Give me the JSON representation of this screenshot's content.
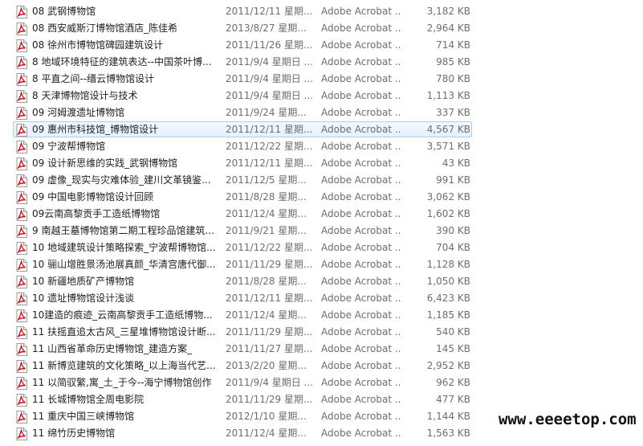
{
  "files": [
    {
      "name": "08 武钢博物馆",
      "date": "2011/12/11 星期...",
      "type": "Adobe Acrobat ...",
      "size": "3,182 KB"
    },
    {
      "name": "08 西安威斯汀博物馆酒店_陈佳希",
      "date": "2013/8/27 星期...",
      "type": "Adobe Acrobat ...",
      "size": "2,964 KB"
    },
    {
      "name": "08 徐州市博物馆碑园建筑设计",
      "date": "2011/11/26 星期...",
      "type": "Adobe Acrobat ...",
      "size": "714 KB"
    },
    {
      "name": "8 地域环境特征的建筑表达--中国茶叶博...",
      "date": "2011/9/4 星期日 ...",
      "type": "Adobe Acrobat ...",
      "size": "985 KB"
    },
    {
      "name": "8 平直之间--缙云博物馆设计",
      "date": "2011/9/4 星期日 ...",
      "type": "Adobe Acrobat ...",
      "size": "780 KB"
    },
    {
      "name": "8 天津博物馆设计与技术",
      "date": "2011/9/4 星期日 ...",
      "type": "Adobe Acrobat ...",
      "size": "1,113 KB"
    },
    {
      "name": "09 河姆渡遗址博物馆",
      "date": "2011/9/24 星期...",
      "type": "Adobe Acrobat ...",
      "size": "337 KB"
    },
    {
      "name": "09 惠州市科技馆_博物馆设计",
      "date": "2011/12/11 星期...",
      "type": "Adobe Acrobat ...",
      "size": "4,567 KB"
    },
    {
      "name": "09 宁波帮博物馆",
      "date": "2011/12/22 星期...",
      "type": "Adobe Acrobat ...",
      "size": "3,571 KB"
    },
    {
      "name": "09 设计新思维的实践_武钢博物馆",
      "date": "2011/12/11 星期...",
      "type": "Adobe Acrobat ...",
      "size": "43 KB"
    },
    {
      "name": "09 虚像_现实与灾难体验_建川文革镜鉴...",
      "date": "2011/12/5 星期...",
      "type": "Adobe Acrobat ...",
      "size": "991 KB"
    },
    {
      "name": "09 中国电影博物馆设计回顾",
      "date": "2011/8/28 星期...",
      "type": "Adobe Acrobat ...",
      "size": "3,062 KB"
    },
    {
      "name": "09云南高黎贡手工造纸博物馆",
      "date": "2011/12/4 星期...",
      "type": "Adobe Acrobat ...",
      "size": "1,602 KB"
    },
    {
      "name": "9 南越王墓博物馆第二期工程珍品馆建筑...",
      "date": "2011/9/21 星期...",
      "type": "Adobe Acrobat ...",
      "size": "390 KB"
    },
    {
      "name": "10 地域建筑设计策略探索_宁波帮博物馆...",
      "date": "2011/12/22 星期...",
      "type": "Adobe Acrobat ...",
      "size": "704 KB"
    },
    {
      "name": "10 骊山增胜景汤池展真颜_华清宫唐代御...",
      "date": "2011/11/29 星期...",
      "type": "Adobe Acrobat ...",
      "size": "1,128 KB"
    },
    {
      "name": "10 新疆地质矿产博物馆",
      "date": "2011/8/28 星期...",
      "type": "Adobe Acrobat ...",
      "size": "1,050 KB"
    },
    {
      "name": "10 遗址博物馆设计浅谈",
      "date": "2011/12/11 星期...",
      "type": "Adobe Acrobat ...",
      "size": "6,423 KB"
    },
    {
      "name": "10建造的痕迹_云南高黎贡手工造纸博物...",
      "date": "2011/12/4 星期...",
      "type": "Adobe Acrobat ...",
      "size": "1,185 KB"
    },
    {
      "name": "11 扶摇直追太古风_三星堆博物馆设计断...",
      "date": "2011/11/29 星期...",
      "type": "Adobe Acrobat ...",
      "size": "540 KB"
    },
    {
      "name": "11 山西省革命历史博物馆_建造方案_",
      "date": "2011/11/27 星期...",
      "type": "Adobe Acrobat ...",
      "size": "145 KB"
    },
    {
      "name": "11 新博览建筑的文化策略_以上海当代艺...",
      "date": "2013/2/20 星期...",
      "type": "Adobe Acrobat ...",
      "size": "2,952 KB"
    },
    {
      "name": "11 以简驭繁,寓_土_于今--海宁博物馆创作",
      "date": "2011/9/4 星期日 ...",
      "type": "Adobe Acrobat ...",
      "size": "962 KB"
    },
    {
      "name": "11 长城博物馆全周电影院",
      "date": "2011/11/29 星期...",
      "type": "Adobe Acrobat ...",
      "size": "477 KB"
    },
    {
      "name": "11 重庆中国三峡博物馆",
      "date": "2012/1/10 星期...",
      "type": "Adobe Acrobat ...",
      "size": "1,144 KB"
    },
    {
      "name": "11 绵竹历史博物馆",
      "date": "2011/12/4 星期...",
      "type": "Adobe Acrobat ...",
      "size": "1,563 KB"
    }
  ],
  "selected_index": 7,
  "watermark": "www.eeeetop.com",
  "colors": {
    "selection_border": "#a9d0f5",
    "selection_fill": "#e4f1fd",
    "pdf_icon_red": "#c8161d",
    "secondary_text": "#6d6d6d"
  },
  "icon": "pdf-file-icon"
}
